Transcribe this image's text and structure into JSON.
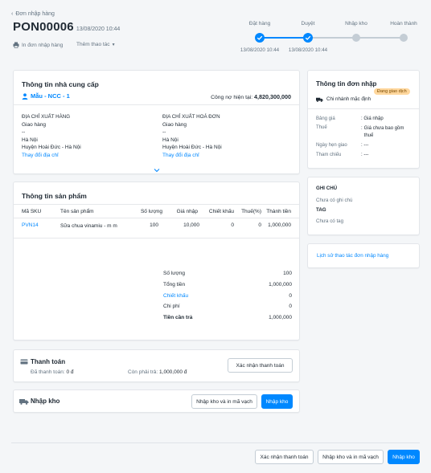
{
  "header": {
    "back_label": "Đơn nhập hàng",
    "order_code": "PON00006",
    "order_date": "13/08/2020 10:44",
    "print_label": "In đơn nhập hàng",
    "more_label": "Thêm thao tác"
  },
  "steps": [
    {
      "label": "Đặt hàng",
      "date": "13/08/2020 10:44",
      "done": true
    },
    {
      "label": "Duyệt",
      "date": "13/08/2020 10:44",
      "done": true
    },
    {
      "label": "Nhập kho",
      "date": "",
      "done": false
    },
    {
      "label": "Hoàn thành",
      "date": "",
      "done": false
    }
  ],
  "supplier": {
    "title": "Thông tin nhà cung cấp",
    "name": "Mẫu - NCC - 1",
    "debt_label": "Công nợ hiện tại:",
    "debt_value": "4,820,300,000",
    "ship_addr": {
      "title": "ĐỊA CHỈ XUẤT HÀNG",
      "lines": [
        "Giao hàng",
        "--",
        "Hà Nội",
        "Huyện Hoài Đức - Hà Nội"
      ],
      "change": "Thay đổi địa chỉ"
    },
    "bill_addr": {
      "title": "ĐỊA CHỈ XUẤT HOÁ ĐƠN",
      "lines": [
        "Giao hàng",
        "--",
        "Hà Nội",
        "Huyện Hoài Đức - Hà Nội"
      ],
      "change": "Thay đổi địa chỉ"
    }
  },
  "products": {
    "title": "Thông tin sản phẩm",
    "columns": [
      "Mã SKU",
      "Tên sản phẩm",
      "Số lượng",
      "Giá nhập",
      "Chiết khấu",
      "Thuế(%)",
      "Thành tiền"
    ],
    "rows": [
      {
        "sku": "PVN14",
        "name": "Sữa chua vinamiu - m m",
        "qty": "100",
        "price": "10,000",
        "discount": "0",
        "tax": "0",
        "total": "1,000,000"
      }
    ],
    "summary": {
      "qty_label": "Số lượng",
      "qty": "100",
      "subtotal_label": "Tổng tiền",
      "subtotal": "1,000,000",
      "discount_label": "Chiết khấu",
      "discount": "0",
      "cost_label": "Chi phí",
      "cost": "0",
      "topay_label": "Tiền cần trả",
      "topay": "1,000,000"
    }
  },
  "payment": {
    "title": "Thanh toán",
    "paid_label": "Đã thanh toán:",
    "paid": "0 đ",
    "remaining_label": "Còn phải trả:",
    "remaining": "1,000,000 đ",
    "confirm_btn": "Xác nhận thanh toán"
  },
  "receive": {
    "title": "Nhập kho",
    "print_btn": "Nhập kho và in mã vạch",
    "btn": "Nhập kho"
  },
  "order_info": {
    "title": "Thông tin đơn nhập",
    "status": "Đang giao dịch",
    "branch": "Chi nhánh mặc định",
    "fields": [
      {
        "label": "Bảng giá",
        "value": "Giá nhập"
      },
      {
        "label": "Thuế",
        "value": "Giá chưa bao gồm thuế"
      },
      {
        "label": "Ngày hẹn giao",
        "value": "---"
      },
      {
        "label": "Tham chiếu",
        "value": "---"
      }
    ]
  },
  "notes": {
    "note_title": "GHI CHÚ",
    "note_value": "Chưa có ghi chú",
    "tag_title": "TAG",
    "tag_value": "Chưa có tag"
  },
  "history_link": "Lịch sử thao tác đơn nhập hàng",
  "footer": {
    "confirm_btn": "Xác nhận thanh toán",
    "print_btn": "Nhập kho và in mã vạch",
    "btn": "Nhập kho"
  },
  "colors": {
    "accent": "#0088ff",
    "badge_bg": "#ffd79d",
    "step_todo": "#c4cdd5"
  }
}
